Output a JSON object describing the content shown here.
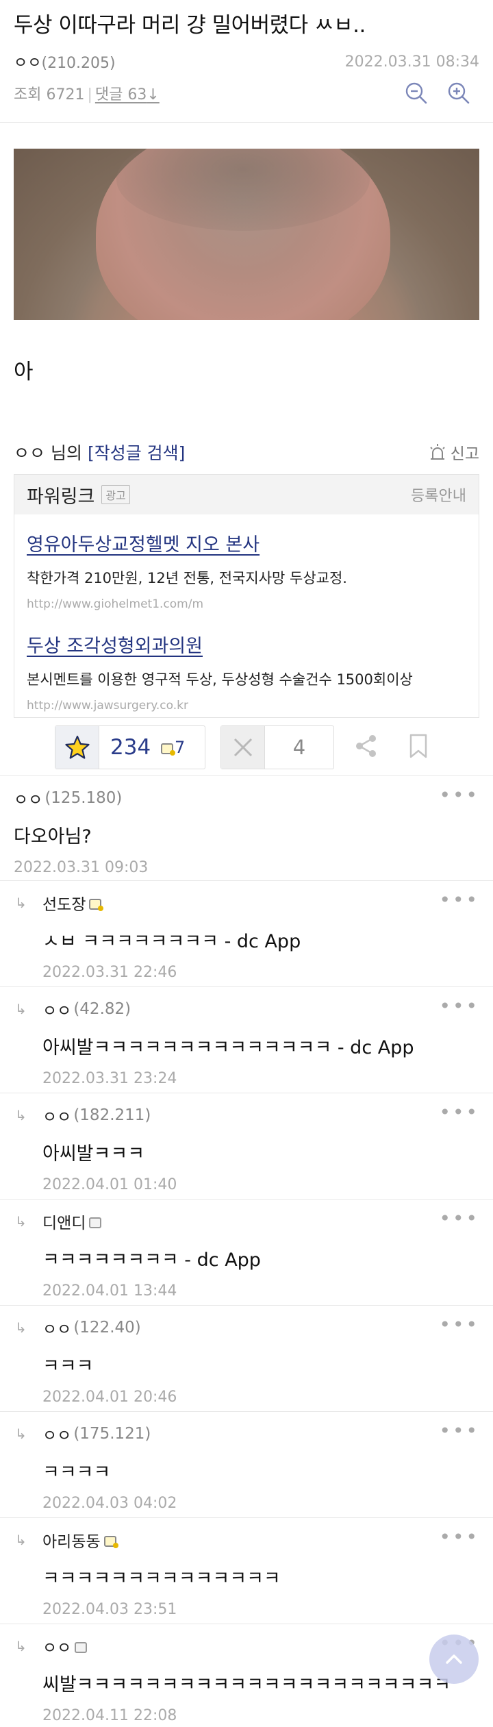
{
  "post": {
    "title": "두상 이따구라 머리 걍 밀어버렸다 ㅆㅂ..",
    "author_name": "ㅇㅇ",
    "author_ip": "(210.205)",
    "date": "2022.03.31 08:34",
    "views_label": "조회 6721",
    "comments_label": "댓글 63",
    "body_text": "아"
  },
  "writer": {
    "name": "ㅇㅇ",
    "suffix": "님의",
    "search_label": "[작성글 검색]",
    "report_label": "신고"
  },
  "powerlink": {
    "title": "파워링크",
    "badge": "광고",
    "register_label": "등록안내",
    "ads": [
      {
        "title": "영유아두상교정헬멧 지오 본사",
        "desc": "착한가격 210만원, 12년 전통, 전국지사망 두상교정.",
        "url": "http://www.giohelmet1.com/m"
      },
      {
        "title": "두상 조각성형외과의원",
        "desc": "본시멘트를 이용한 영구적 두상, 두상성형 수술건수 1500회이상",
        "url": "http://www.jawsurgery.co.kr"
      }
    ]
  },
  "votes": {
    "up_count": "234",
    "fix_count": "7",
    "down_count": "4"
  },
  "comments": [
    {
      "author": "ㅇㅇ",
      "ip": "(125.180)",
      "text": "다오아님?",
      "date": "2022.03.31 09:03",
      "reply": false,
      "badge": ""
    },
    {
      "author": "선도장",
      "ip": "",
      "text": "ㅅㅂ ㅋㅋㅋㅋㅋㅋㅋㅋ - dc App",
      "date": "2022.03.31 22:46",
      "reply": true,
      "badge": "fixed"
    },
    {
      "author": "ㅇㅇ",
      "ip": "(42.82)",
      "text": "아씨발ㅋㅋㅋㅋㅋㅋㅋㅋㅋㅋㅋㅋㅋㅋ - dc App",
      "date": "2022.03.31 23:24",
      "reply": true,
      "badge": ""
    },
    {
      "author": "ㅇㅇ",
      "ip": "(182.211)",
      "text": "아씨발ㅋㅋㅋ",
      "date": "2022.04.01 01:40",
      "reply": true,
      "badge": ""
    },
    {
      "author": "디앤디",
      "ip": "",
      "text": "ㅋㅋㅋㅋㅋㅋㅋㅋ - dc App",
      "date": "2022.04.01 13:44",
      "reply": true,
      "badge": "flow"
    },
    {
      "author": "ㅇㅇ",
      "ip": "(122.40)",
      "text": "ㅋㅋㅋ",
      "date": "2022.04.01 20:46",
      "reply": true,
      "badge": ""
    },
    {
      "author": "ㅇㅇ",
      "ip": "(175.121)",
      "text": "ㅋㅋㅋㅋ",
      "date": "2022.04.03 04:02",
      "reply": true,
      "badge": ""
    },
    {
      "author": "아리동동",
      "ip": "",
      "text": "ㅋㅋㅋㅋㅋㅋㅋㅋㅋㅋㅋㅋㅋㅋ",
      "date": "2022.04.03 23:51",
      "reply": true,
      "badge": "fixed"
    },
    {
      "author": "ㅇㅇ",
      "ip": "",
      "text": "씨발ㅋㅋㅋㅋㅋㅋㅋㅋㅋㅋㅋㅋㅋㅋㅋㅋㅋㅋㅋㅋㅋㅋ",
      "date": "2022.04.11 22:08",
      "reply": true,
      "badge": "flow"
    }
  ],
  "colors": {
    "link_blue": "#233480",
    "vote_blue": "#2a3c8a",
    "muted": "#aaaaaa"
  }
}
